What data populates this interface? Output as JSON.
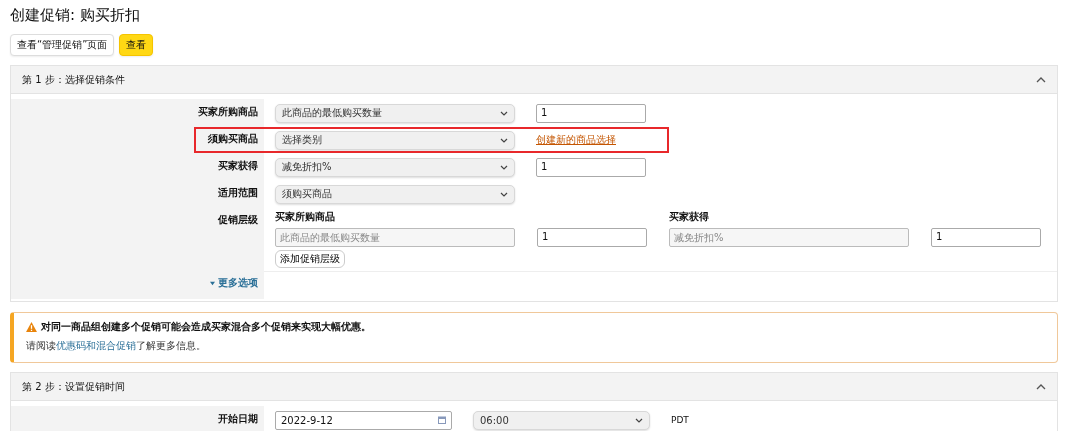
{
  "page_title": "创建促销: 购买折扣",
  "top_buttons": [
    {
      "label": "查看“管理促销”页面",
      "kind": "plain"
    },
    {
      "label": "查看",
      "kind": "primary"
    }
  ],
  "step1": {
    "title": "第 1 步：选择促销条件",
    "expanded": true,
    "rows": [
      {
        "label": "买家所购商品",
        "select": "此商品的最低购买数量",
        "input": "1",
        "highlighted": false
      },
      {
        "label": "须购买商品",
        "select": "选择类别",
        "link": "创建新的商品选择",
        "highlighted": true
      },
      {
        "label": "买家获得",
        "select": "减免折扣%",
        "input": "1",
        "highlighted": false
      },
      {
        "label": "适用范围",
        "select": "须购买商品",
        "highlighted": false
      }
    ],
    "tiers": {
      "label": "促销层级",
      "headings": [
        "买家所购商品",
        "买家获得"
      ],
      "fields": [
        {
          "value": "此商品的最低购买数量",
          "disabled": true
        },
        {
          "value": "1",
          "disabled": false
        },
        {
          "value": "减免折扣%",
          "disabled": true
        },
        {
          "value": "1",
          "disabled": false
        }
      ],
      "add_button": "添加促销层级"
    },
    "more_options": "更多选项"
  },
  "alert": {
    "title": "对同一商品组创建多个促销可能会造成买家混合多个促销来实现大幅优惠。",
    "before": "请阅读",
    "link": "优惠码和混合促销",
    "after": "了解更多信息。"
  },
  "step2": {
    "title": "第 2 步：设置促销时间",
    "expanded": true,
    "start_label": "开始日期",
    "date": "2022-9-12",
    "time": "06:00",
    "timezone": "PDT"
  }
}
